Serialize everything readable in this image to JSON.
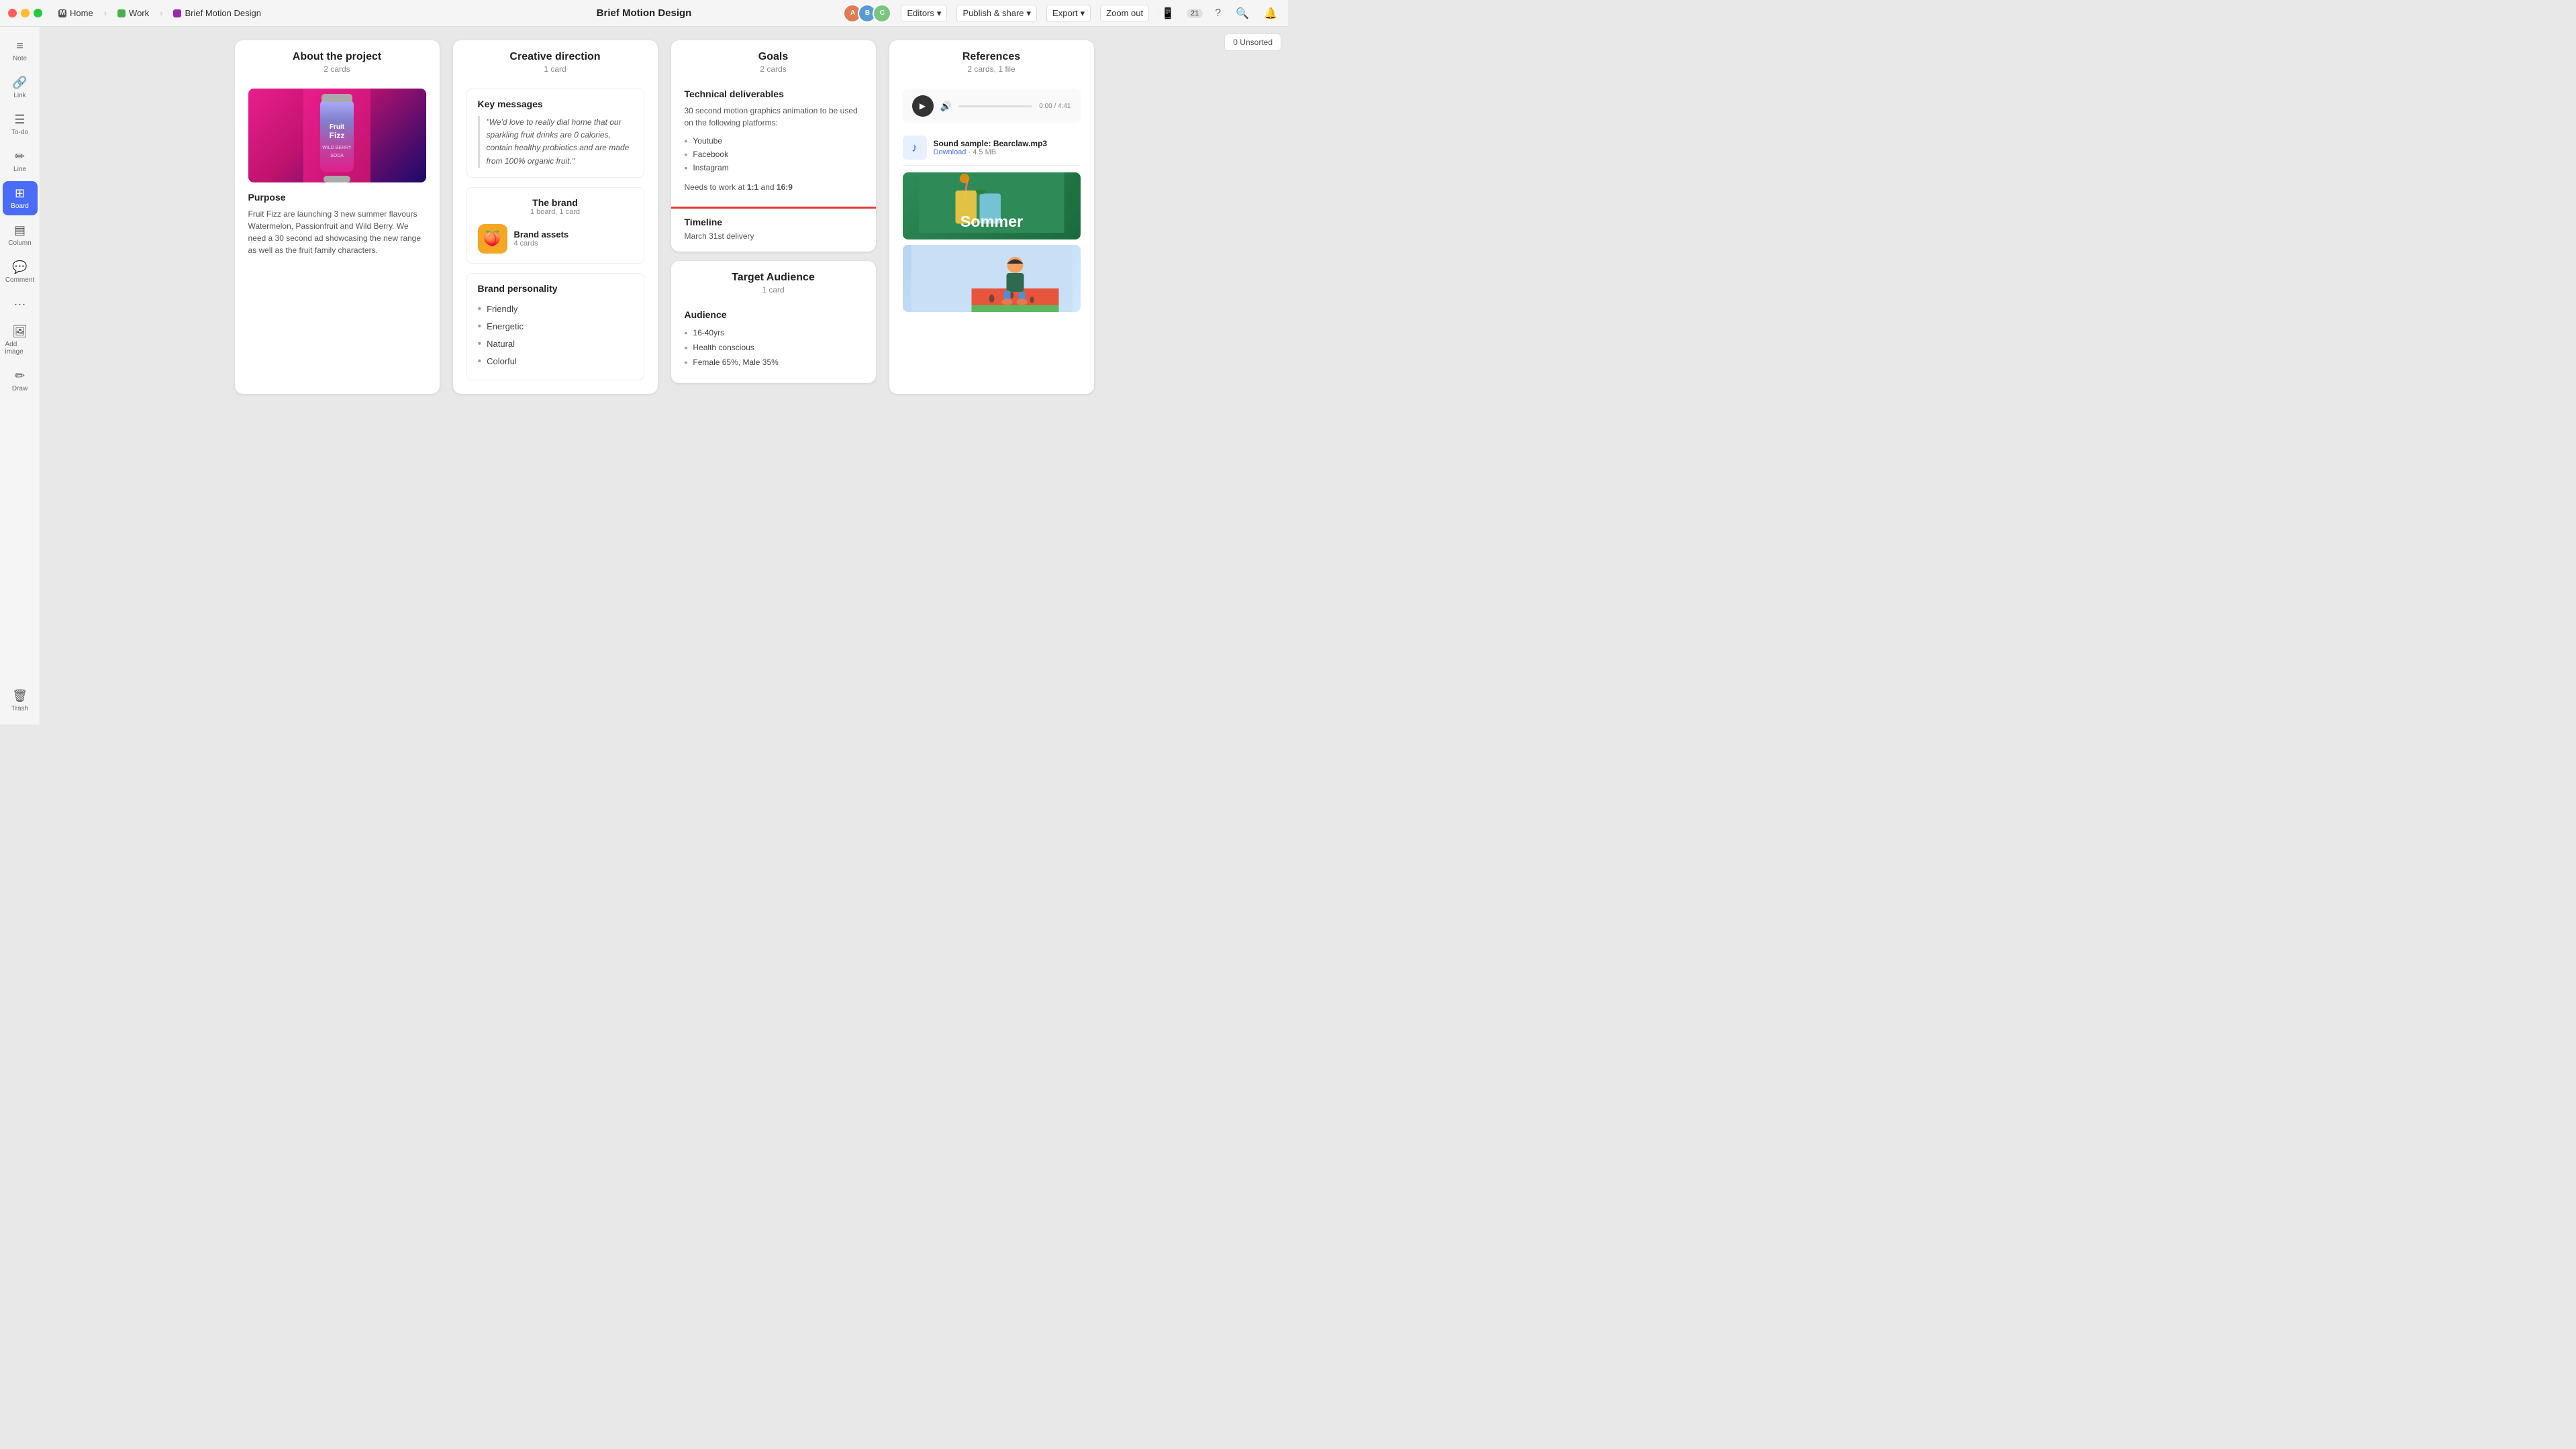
{
  "titlebar": {
    "title": "Brief Motion Design",
    "nav": {
      "home": "Home",
      "work": "Work",
      "current": "Brief Motion Design"
    },
    "notifications": "21",
    "editors_label": "Editors",
    "publish_label": "Publish & share",
    "export_label": "Export",
    "zoom_label": "Zoom out"
  },
  "unsorted": "0 Unsorted",
  "sidebar": {
    "items": [
      {
        "id": "note",
        "icon": "≡",
        "label": "Note"
      },
      {
        "id": "link",
        "icon": "🔗",
        "label": "Link"
      },
      {
        "id": "todo",
        "icon": "☰",
        "label": "To-do"
      },
      {
        "id": "line",
        "icon": "✏",
        "label": "Line"
      },
      {
        "id": "board",
        "icon": "⊞",
        "label": "Board"
      },
      {
        "id": "column",
        "icon": "▤",
        "label": "Column"
      },
      {
        "id": "comment",
        "icon": "💬",
        "label": "Comment"
      },
      {
        "id": "more",
        "icon": "···",
        "label": ""
      },
      {
        "id": "image",
        "icon": "🖼",
        "label": "Add image"
      },
      {
        "id": "draw",
        "icon": "✏",
        "label": "Draw"
      }
    ],
    "trash_label": "Trash"
  },
  "board": {
    "columns": [
      {
        "id": "about",
        "title": "About the project",
        "subtitle": "2 cards",
        "sections": [
          {
            "type": "image",
            "alt": "Fruit Fizz can"
          },
          {
            "type": "text",
            "title": "Purpose",
            "body": "Fruit Fizz are launching 3 new summer flavours Watermelon, Passionfruit and Wild Berry. We need a 30 second ad showcasing the new range as well as the fruit family characters."
          }
        ]
      },
      {
        "id": "creative",
        "title": "Creative direction",
        "subtitle": "1 card",
        "sections": [
          {
            "type": "key_messages",
            "title": "Key messages",
            "quote": "\"We'd love to really dial home that our sparkling fruit drinks are 0 calories, contain healthy probiotics and are made from 100% organic fruit.\""
          },
          {
            "type": "brand",
            "title": "The brand",
            "subtitle": "1 board, 1 card",
            "asset_name": "Brand assets",
            "asset_cards": "4 cards"
          },
          {
            "type": "personality",
            "title": "Brand personality",
            "traits": [
              "Friendly",
              "Energetic",
              "Natural",
              "Colorful"
            ]
          }
        ]
      },
      {
        "id": "goals",
        "title": "Goals",
        "subtitle": "2 cards",
        "sections": [
          {
            "type": "deliverables",
            "title": "Technical deliverables",
            "intro": "30 second motion graphics animation to be used on the following platforms:",
            "platforms": [
              "Youtube",
              "Facebook",
              "Instagram"
            ],
            "ratio_text_pre": "Needs to work at ",
            "ratio_bold1": "1:1",
            "ratio_and": " and ",
            "ratio_bold2": "16:9"
          },
          {
            "type": "timeline",
            "title": "Timeline",
            "date": "March 31st delivery"
          }
        ],
        "target_audience": {
          "title": "Target Audience",
          "subtitle": "1 card",
          "section_title": "Audience",
          "items": [
            "16-40yrs",
            "Health conscious",
            "Female 65%, Male 35%"
          ]
        }
      },
      {
        "id": "references",
        "title": "References",
        "subtitle": "2 cards, 1 file",
        "audio": {
          "time": "0:00 / 4:41"
        },
        "file": {
          "name": "Sound sample: Bearclaw.mp3",
          "download_label": "Download",
          "size": "4.5 MB"
        },
        "images": [
          {
            "type": "sommer",
            "text": "Sommer"
          },
          {
            "type": "watermelon"
          }
        ]
      }
    ]
  }
}
